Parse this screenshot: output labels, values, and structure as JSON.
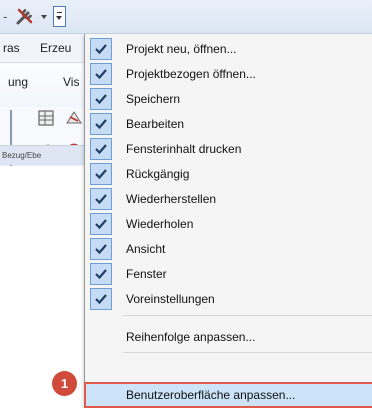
{
  "quick_access": {
    "icons": [
      "dash-icon",
      "tools-icon",
      "customize-dropdown-icon"
    ]
  },
  "menubar": {
    "items": [
      "ras",
      "Erzeu"
    ]
  },
  "ribbon": {
    "tabs": [
      "ung",
      "Vis"
    ],
    "group_label": "Bezug/Ebe"
  },
  "menu": {
    "checked_items": [
      "Projekt neu, öffnen...",
      "Projektbezogen öffnen...",
      "Speichern",
      "Bearbeiten",
      "Fensterinhalt drucken",
      "Rückgängig",
      "Wiederherstellen",
      "Wiederholen",
      "Ansicht",
      "Fenster",
      "Voreinstellungen"
    ],
    "reorder_label": "Reihenfolge anpassen...",
    "customize_ui_label": "Benutzeroberfläche anpassen..."
  },
  "callout": {
    "step_number": "1",
    "color": "#e05a4a"
  },
  "colors": {
    "check_bg": "#c5dcf4",
    "check_mark": "#1f3f66",
    "highlight": "#cde3f7"
  }
}
